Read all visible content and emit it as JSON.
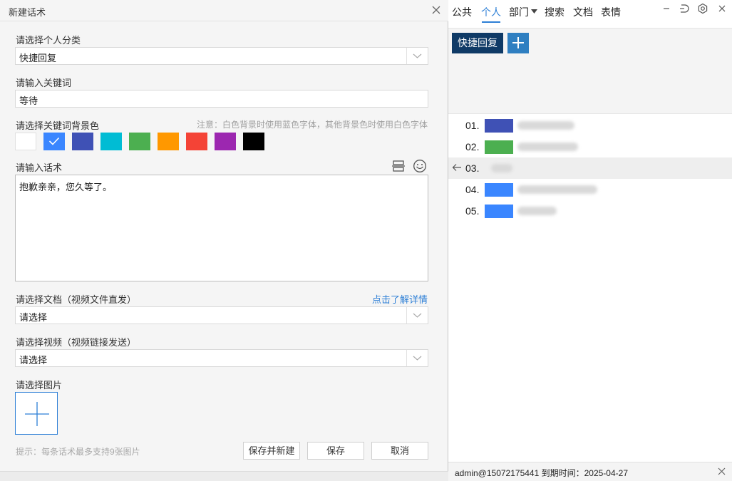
{
  "dialog": {
    "title": "新建话术",
    "category_label": "请选择个人分类",
    "category_value": "快捷回复",
    "keyword_label": "请输入关键词",
    "keyword_value": "等待",
    "color_label": "请选择关键词背景色",
    "color_note": "注意：白色背景时使用蓝色字体，其他背景色时使用白色字体",
    "colors": [
      "#ffffff",
      "#3a86ff",
      "#3f51b5",
      "#00bcd4",
      "#4caf50",
      "#ff9800",
      "#f44336",
      "#9c27b0",
      "#000000"
    ],
    "selected_color_index": 1,
    "script_label": "请输入话术",
    "script_value": "抱歉亲亲，您久等了。",
    "doc_label": "请选择文档（视频文件直发）",
    "doc_link": "点击了解详情",
    "doc_value": "请选择",
    "video_label": "请选择视频（视频链接发送）",
    "video_value": "请选择",
    "image_label": "请选择图片",
    "hint": "提示：每条话术最多支持9张图片",
    "btn_save_new": "保存并新建",
    "btn_save": "保存",
    "btn_cancel": "取消"
  },
  "panel": {
    "tabs": [
      "公共",
      "个人",
      "部门",
      "搜索",
      "文档",
      "表情"
    ],
    "active_tab": "个人",
    "chip_label": "快捷回复",
    "rows": [
      {
        "num": "01.",
        "tag_color": "#3f51b5"
      },
      {
        "num": "02.",
        "tag_color": "#4caf50"
      },
      {
        "num": "03.",
        "tag_color": "#ffffff"
      },
      {
        "num": "04.",
        "tag_color": "#3a86ff"
      },
      {
        "num": "05.",
        "tag_color": "#3a86ff"
      }
    ],
    "status": "admin@15072175441   到期时间：2025-04-27"
  },
  "colors": {
    "accent": "#2d7fd6",
    "chip": "#0f3a66",
    "plus": "#2f7fc1"
  }
}
